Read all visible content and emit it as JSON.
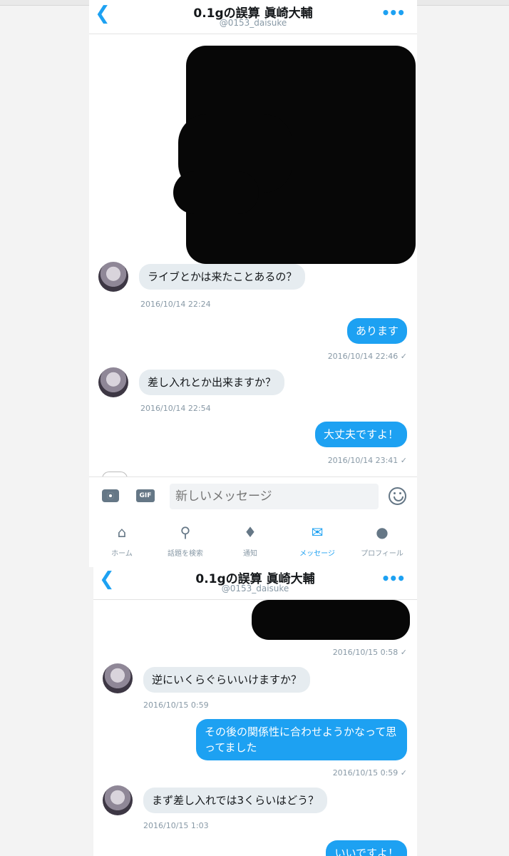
{
  "conversation": {
    "title": "0.1gの誤算 眞崎大輔",
    "handle": "@0153_daisuke"
  },
  "screen1": {
    "messages": [
      {
        "direction": "in",
        "text": "ライブとかは来たことあるの？",
        "time": "2016/10/14 22:24"
      },
      {
        "direction": "out",
        "text": "あります",
        "time": "2016/10/14 22:46 ✓"
      },
      {
        "direction": "in",
        "text": "差し入れとか出来ますか？",
        "time": "2016/10/14 22:54"
      },
      {
        "direction": "out",
        "text": "大丈夫ですよ！",
        "time": "2016/10/14 23:41 ✓"
      }
    ],
    "composer": {
      "gif_label": "GIF",
      "placeholder": "新しいメッセージ"
    },
    "tabs": [
      {
        "label": "ホーム",
        "icon": "home-icon"
      },
      {
        "label": "話題を検索",
        "icon": "search-icon"
      },
      {
        "label": "通知",
        "icon": "bell-icon"
      },
      {
        "label": "メッセージ",
        "icon": "mail-icon",
        "active": true
      },
      {
        "label": "プロフィール",
        "icon": "person-icon"
      }
    ]
  },
  "screen2": {
    "messages": [
      {
        "direction": "out",
        "text": "",
        "time": "2016/10/15 0:58 ✓",
        "redacted": true
      },
      {
        "direction": "in",
        "text": "逆にいくらぐらいいけますか？",
        "time": "2016/10/15 0:59"
      },
      {
        "direction": "out",
        "text": "その後の関係性に合わせようかなって思ってました",
        "time": "2016/10/15 0:59 ✓"
      },
      {
        "direction": "in",
        "text": "まず差し入れでは3くらいはどう？",
        "time": "2016/10/15 1:03"
      },
      {
        "direction": "out",
        "text": "いいですよ！",
        "time": ""
      }
    ]
  },
  "colors": {
    "accent": "#1da1f2",
    "incoming_bubble": "#e6ecf0",
    "timestamp": "#8899a6",
    "redaction": "#070707"
  }
}
